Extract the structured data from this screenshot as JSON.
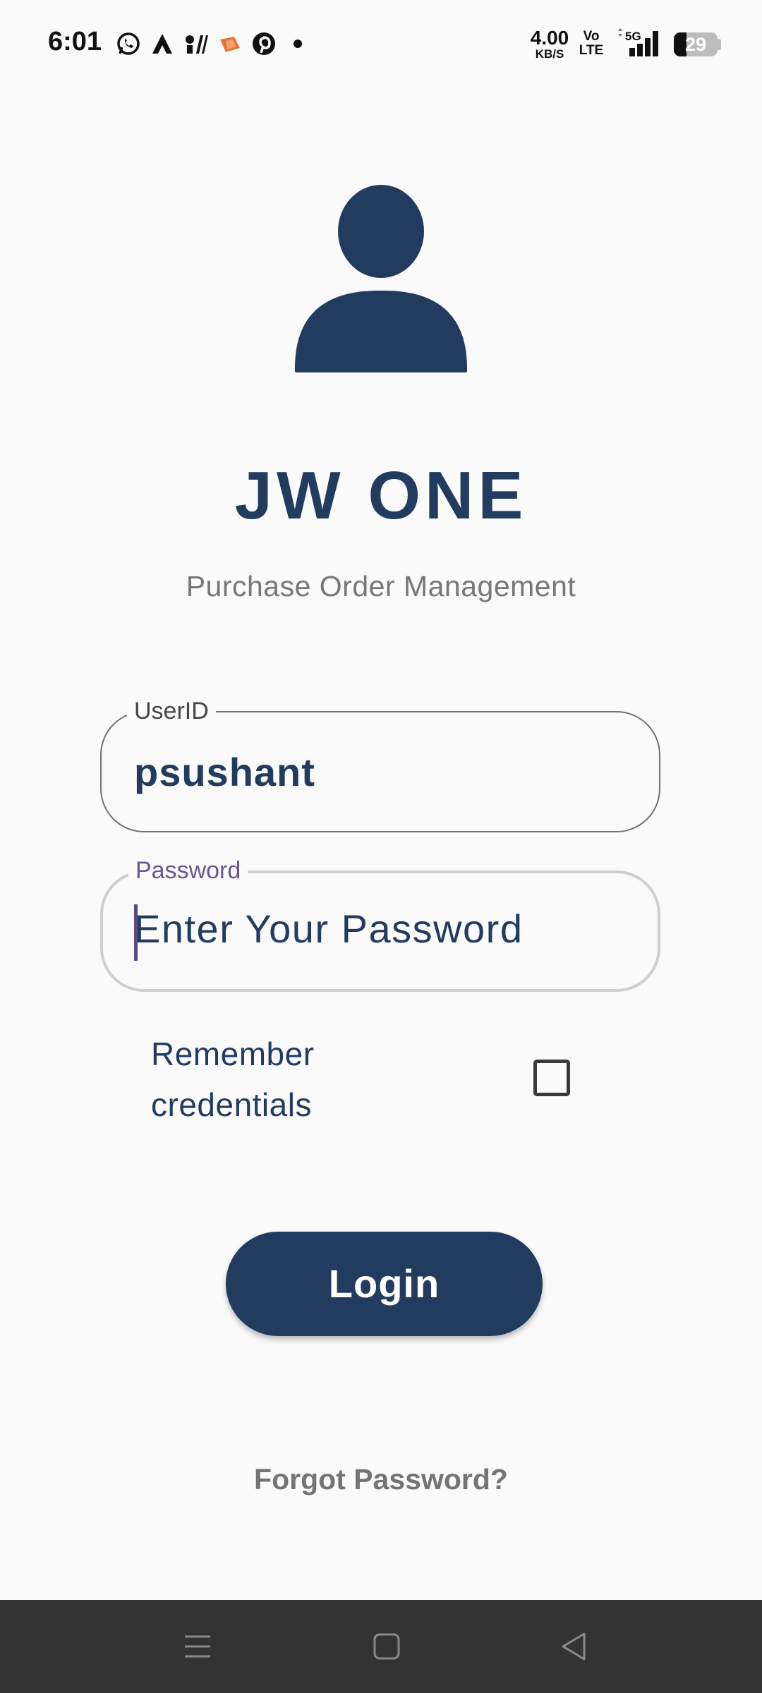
{
  "status_bar": {
    "time": "6:01",
    "net_speed_value": "4.00",
    "net_speed_unit": "KB/S",
    "volte_line1": "Vo",
    "volte_line2": "LTE",
    "network": "5G",
    "battery_level": "29",
    "battery_fraction": 0.29,
    "notification_icons": [
      "whatsapp-icon",
      "arrow-app-icon",
      "ball-app-icon",
      "game-controller-icon",
      "pinterest-icon",
      "more-dot-icon"
    ]
  },
  "header": {
    "app_title": "JW ONE",
    "subtitle": "Purchase Order Management"
  },
  "form": {
    "user_label": "UserID",
    "user_value": "psushant",
    "password_label": "Password",
    "password_placeholder": "Enter Your Password",
    "remember_label": "Remember credentials",
    "remember_checked": false,
    "login_label": "Login",
    "forgot_label": "Forgot Password?"
  },
  "colors": {
    "primary": "#223c60",
    "focus_label": "#6b5690",
    "muted_text": "#777777",
    "background": "#fafafa",
    "nav_bar": "#333333"
  }
}
